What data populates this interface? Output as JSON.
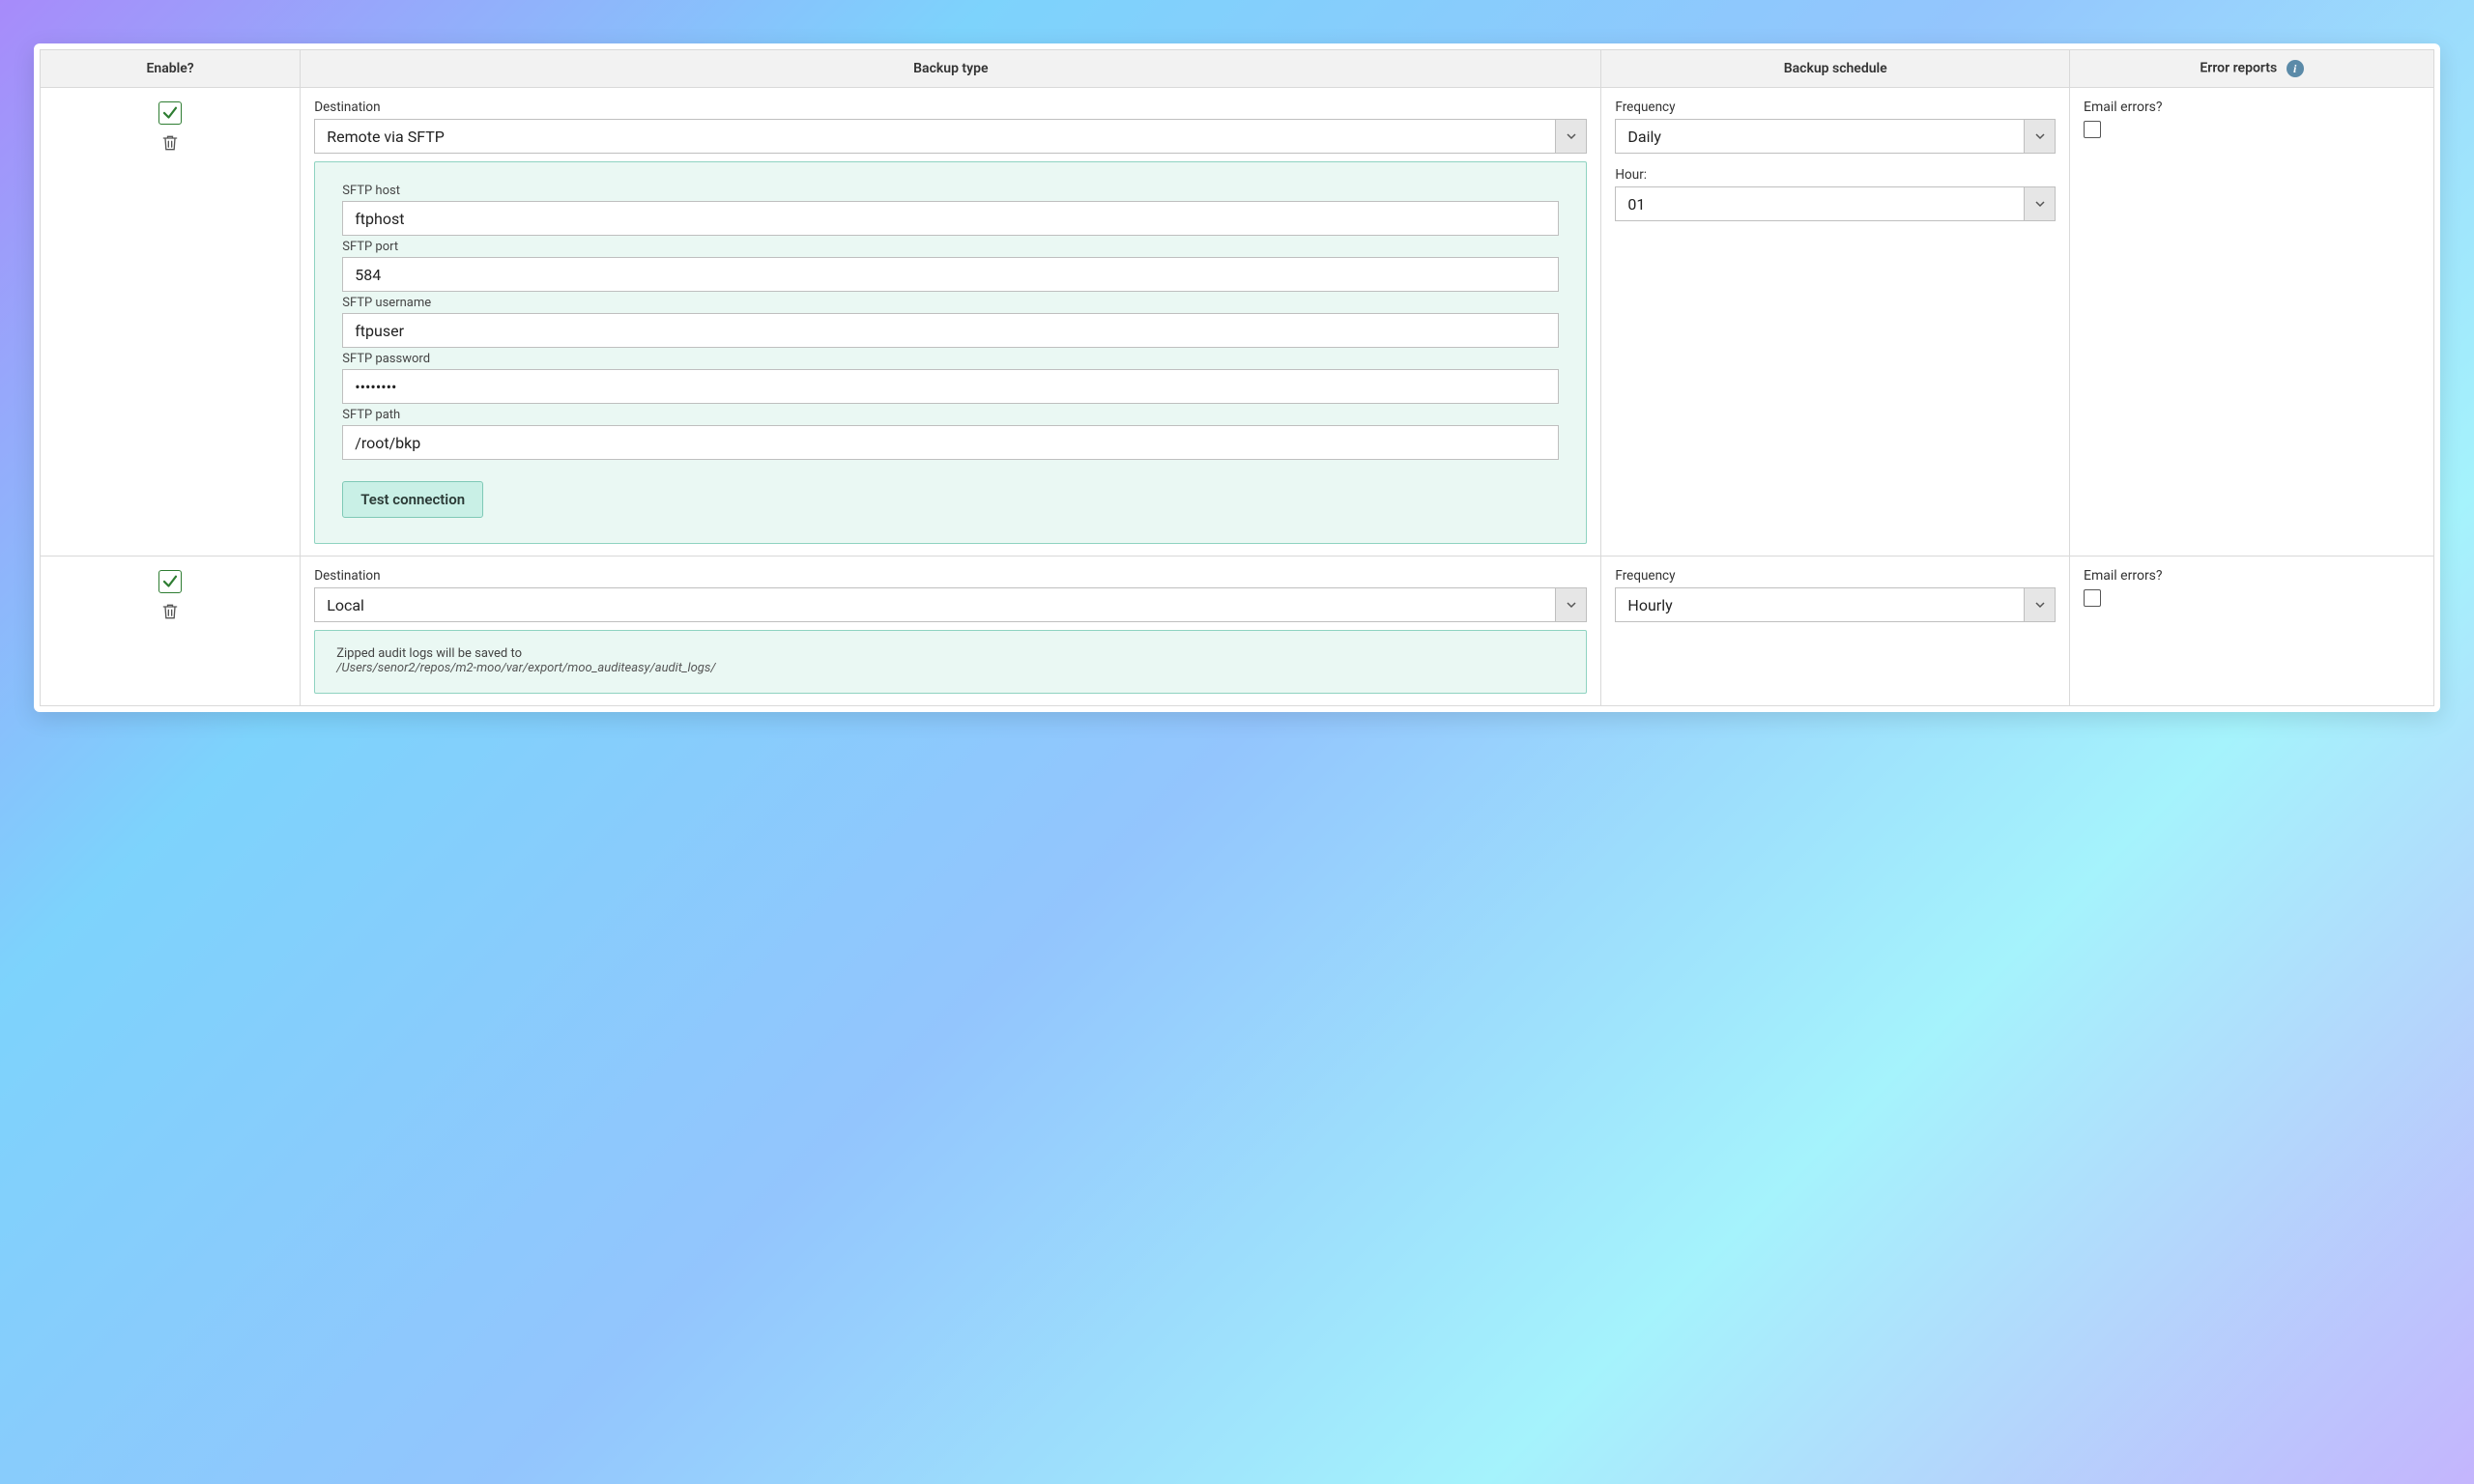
{
  "headers": {
    "enable": "Enable?",
    "type": "Backup type",
    "schedule": "Backup schedule",
    "errors": "Error reports"
  },
  "labels": {
    "destination": "Destination",
    "frequency": "Frequency",
    "hour": "Hour:",
    "email_errors": "Email errors?",
    "sftp_host": "SFTP host",
    "sftp_port": "SFTP port",
    "sftp_user": "SFTP username",
    "sftp_pass": "SFTP password",
    "sftp_path": "SFTP path",
    "test_connection": "Test connection",
    "local_msg_prefix": "Zipped audit logs will be saved to"
  },
  "rows": [
    {
      "enabled": true,
      "destination": "Remote via SFTP",
      "sftp": {
        "host": "ftphost",
        "port": "584",
        "user": "ftpuser",
        "pass": "••••••••",
        "path": "/root/bkp"
      },
      "frequency": "Daily",
      "hour": "01",
      "email_errors": false
    },
    {
      "enabled": true,
      "destination": "Local",
      "local_path": "/Users/senor2/repos/m2-moo/var/export/moo_auditeasy/audit_logs/",
      "frequency": "Hourly",
      "email_errors": false
    }
  ]
}
